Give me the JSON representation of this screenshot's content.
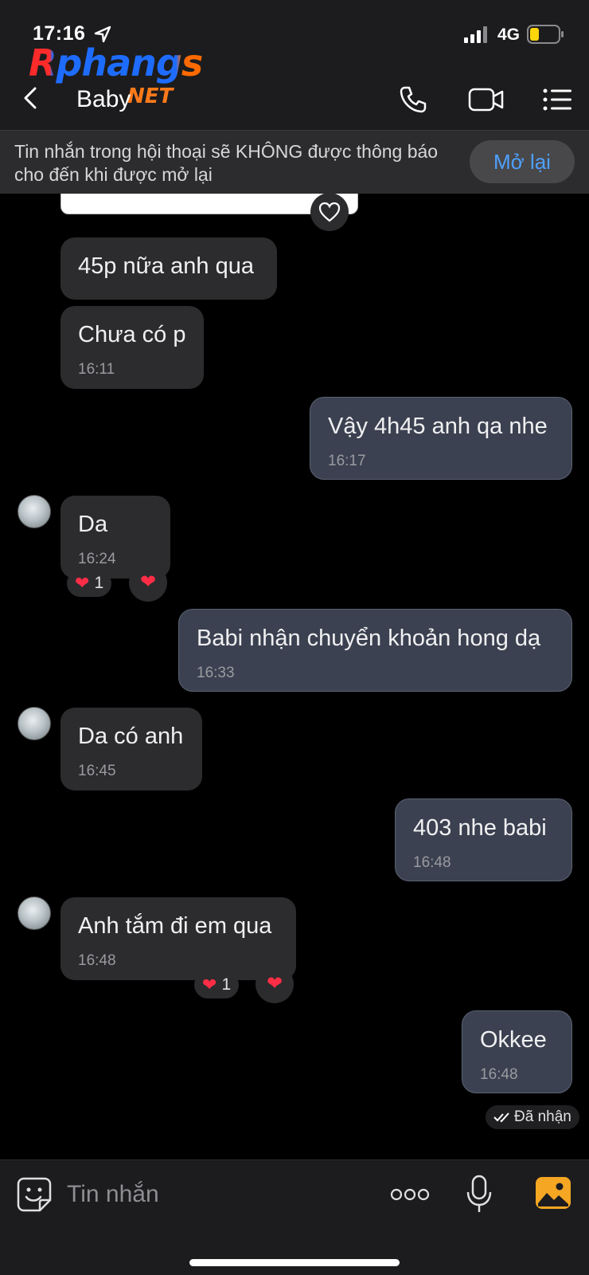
{
  "status": {
    "time": "17:16",
    "network": "4G"
  },
  "watermark": {
    "logo_main": "Rphangs",
    "logo_net": "NET"
  },
  "header": {
    "title": "Baby"
  },
  "notice": {
    "text": "Tin nhắn trong hội thoại sẽ KHÔNG được thông báo cho đến khi được mở lại",
    "button": "Mở lại"
  },
  "messages": [
    {
      "side": "in",
      "text": "45p nữa anh qua",
      "time": ""
    },
    {
      "side": "in",
      "text": "Chưa có p",
      "time": "16:11"
    },
    {
      "side": "out",
      "text": "Vậy 4h45 anh qa nhe",
      "time": "16:17"
    },
    {
      "side": "in",
      "text": "Da",
      "time": "16:24",
      "reaction_count": "1"
    },
    {
      "side": "out",
      "text": "Babi nhận chuyển khoản hong dạ",
      "time": "16:33"
    },
    {
      "side": "in",
      "text": "Da có anh",
      "time": "16:45"
    },
    {
      "side": "out",
      "text": "403 nhe babi",
      "time": "16:48"
    },
    {
      "side": "in",
      "text": "Anh tắm đi em qua",
      "time": "16:48",
      "reaction_count": "1"
    },
    {
      "side": "out",
      "text": "Okkee",
      "time": "16:48"
    }
  ],
  "delivery_status": "Đã nhận",
  "input": {
    "placeholder": "Tin nhắn"
  },
  "icons": {
    "heart": "heart-icon",
    "back": "chevron-left-icon",
    "call": "phone-icon",
    "video": "video-camera-icon",
    "menu": "list-icon",
    "sticker": "sticker-icon",
    "more": "more-icon",
    "mic": "microphone-icon",
    "photo": "photo-icon"
  },
  "colors": {
    "accent": "#4ea0ff",
    "outgoing_bubble": "#3b4150",
    "incoming_bubble": "#2c2c2e",
    "reaction": "#ff2d46"
  }
}
